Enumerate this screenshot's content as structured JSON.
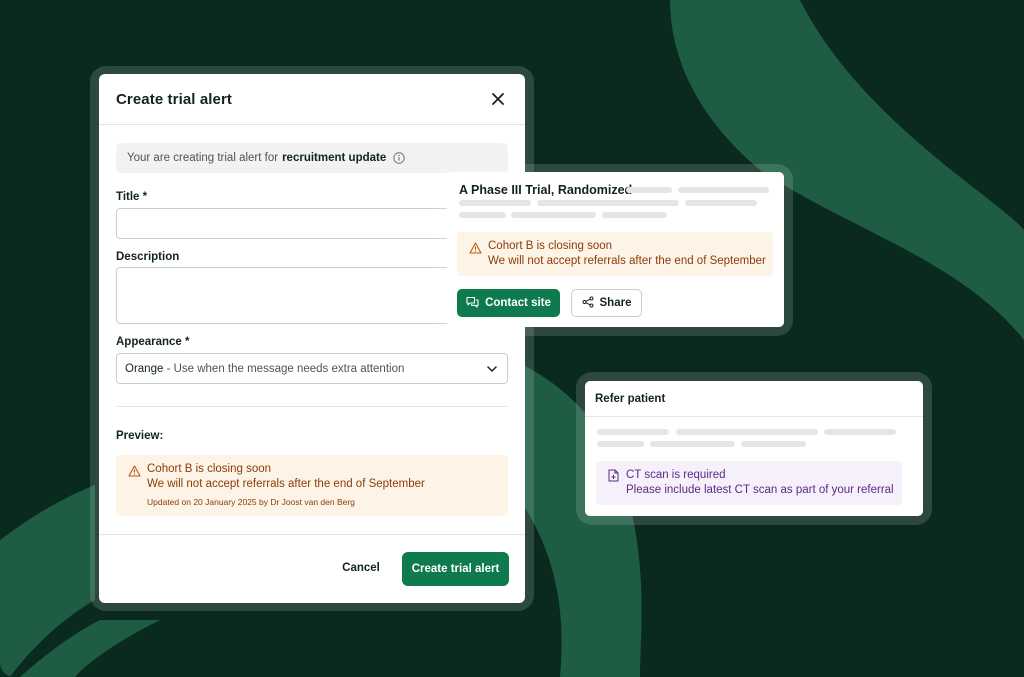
{
  "colors": {
    "background": "#0b2a1f",
    "swoosh": "#1e5c43",
    "primary": "#0e7a4e",
    "alert_orange_bg": "#fdf3e7",
    "alert_orange_text": "#8a3d08",
    "alert_purple_bg": "#f5f0fa",
    "alert_purple_text": "#5b2a86"
  },
  "modal": {
    "title": "Create trial alert",
    "close_icon": "close-icon",
    "info": {
      "prefix": "Your are creating trial alert for",
      "emphasis": "recruitment update",
      "icon": "info-icon"
    },
    "title_field": {
      "label": "Title *",
      "value": ""
    },
    "description_field": {
      "label": "Description",
      "value": ""
    },
    "appearance": {
      "label": "Appearance *",
      "selected_name": "Orange",
      "selected_desc": "- Use when the message needs extra attention",
      "icon": "chevron-down-icon"
    },
    "preview": {
      "label": "Preview:",
      "alert": {
        "icon": "warning-icon",
        "title": "Cohort B is closing soon",
        "body": "We will not accept referrals after the end of September",
        "meta": "Updated on 20 January 2025 by Dr Joost van den Berg"
      }
    },
    "cancel_label": "Cancel",
    "submit_label": "Create trial alert"
  },
  "trial_card": {
    "title": "A Phase III Trial, Randomized",
    "alert": {
      "icon": "warning-icon",
      "title": "Cohort B is closing soon",
      "body": "We will not accept referrals after the end of September"
    },
    "contact_label": "Contact site",
    "contact_icon": "chat-icon",
    "share_label": "Share",
    "share_icon": "share-icon"
  },
  "refer_card": {
    "title": "Refer patient",
    "alert": {
      "icon": "document-icon",
      "title": "CT scan is required",
      "body": "Please include latest CT scan as part of your referral"
    }
  }
}
